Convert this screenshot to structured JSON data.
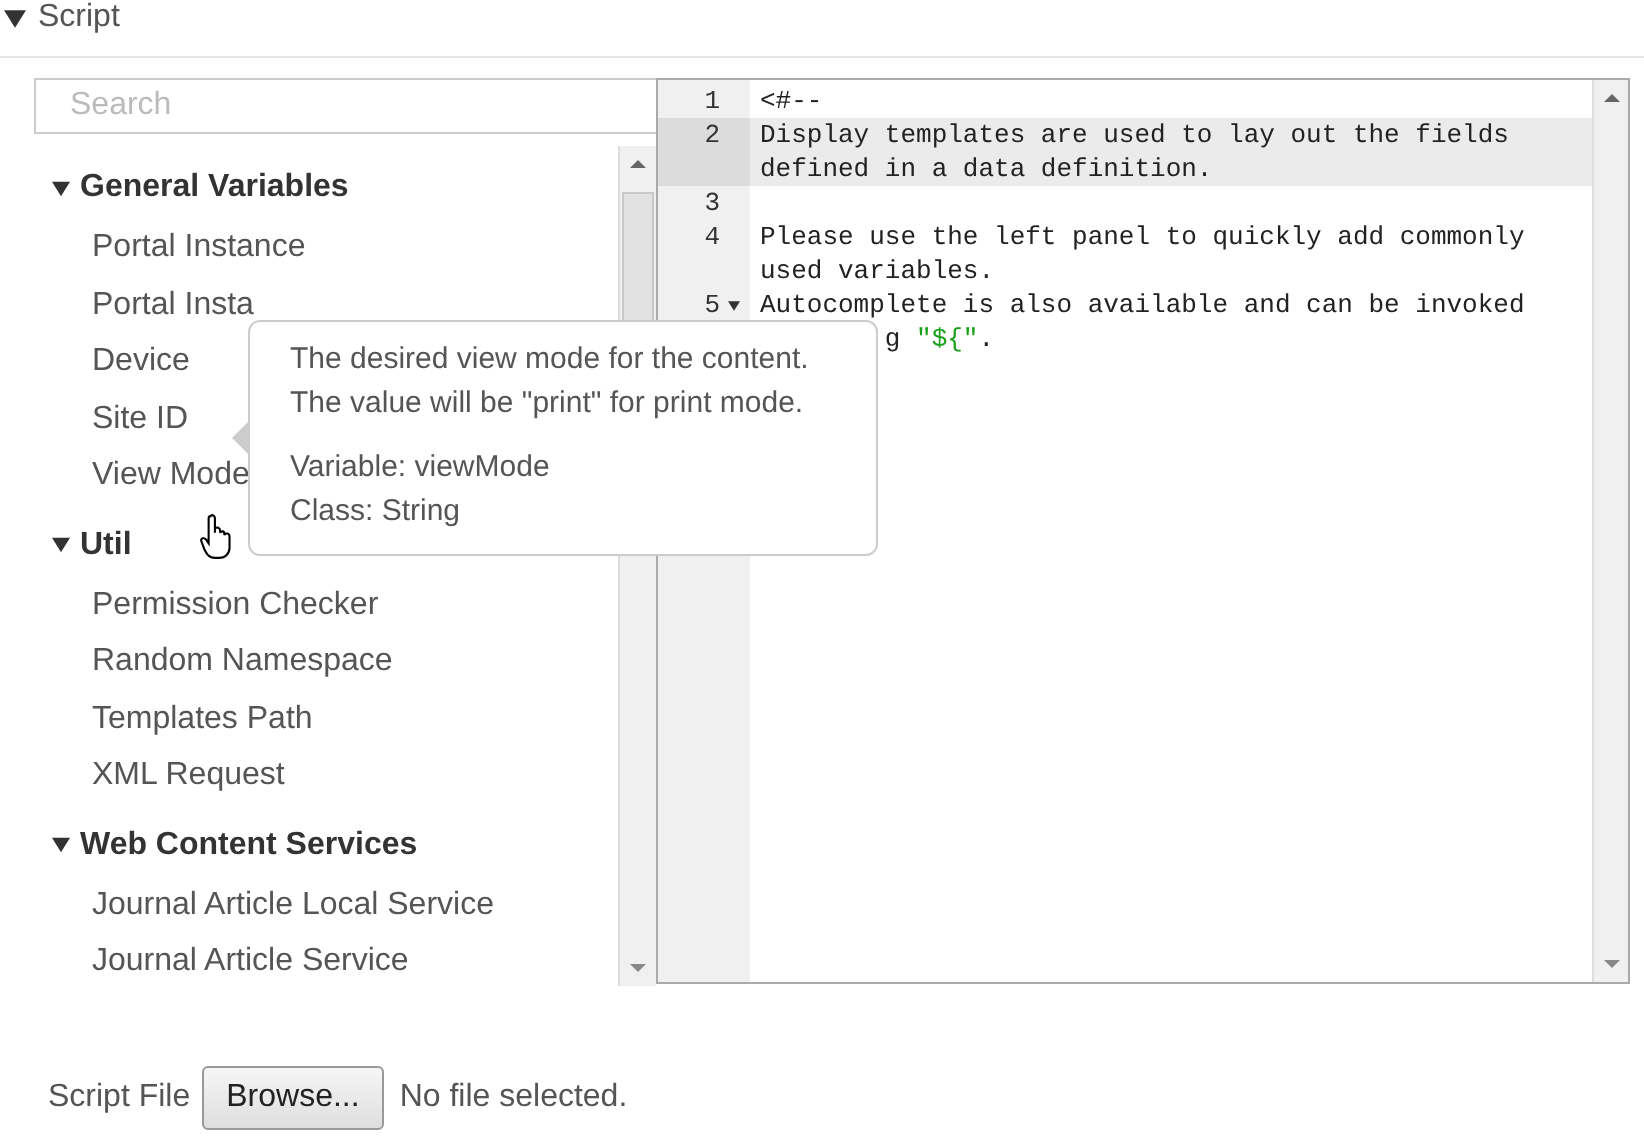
{
  "section": {
    "title": "Script",
    "expanded": true
  },
  "search": {
    "placeholder": "Search"
  },
  "variables": [
    {
      "label": "General Variables",
      "expanded": true,
      "children": [
        {
          "label": "Portal Instance"
        },
        {
          "label": "Portal Insta"
        },
        {
          "label": "Device"
        },
        {
          "label": "Site ID"
        },
        {
          "label": "View Mode"
        }
      ]
    },
    {
      "label": "Util",
      "expanded": true,
      "children": [
        {
          "label": "Permission Checker"
        },
        {
          "label": "Random Namespace"
        },
        {
          "label": "Templates Path"
        },
        {
          "label": "XML Request"
        }
      ]
    },
    {
      "label": "Web Content Services",
      "expanded": true,
      "children": [
        {
          "label": "Journal Article Local Service"
        },
        {
          "label": "Journal Article Service"
        }
      ]
    }
  ],
  "tooltip": {
    "description": [
      "The desired view mode for the content.",
      "The value will be \"print\" for print mode."
    ],
    "details": [
      "Variable: viewMode",
      "Class: String"
    ]
  },
  "editor": {
    "lines": [
      {
        "number": "1",
        "active": false,
        "foldable": false,
        "rows": [
          {
            "cut": false,
            "segments": [
              {
                "kind": "plain",
                "text": "<#--"
              }
            ]
          }
        ]
      },
      {
        "number": "2",
        "active": true,
        "foldable": false,
        "rows": [
          {
            "cut": false,
            "segments": [
              {
                "kind": "plain",
                "text": "Display templates are used to lay out the fields"
              }
            ]
          },
          {
            "cut": false,
            "segments": [
              {
                "kind": "plain",
                "text": "defined in a data definition."
              }
            ]
          }
        ]
      },
      {
        "number": "3",
        "active": false,
        "foldable": false,
        "rows": [
          {
            "cut": false,
            "segments": []
          }
        ]
      },
      {
        "number": "4",
        "active": false,
        "foldable": false,
        "rows": [
          {
            "cut": false,
            "segments": [
              {
                "kind": "plain",
                "text": "Please use the left panel to quickly add commonly"
              }
            ]
          },
          {
            "cut": false,
            "segments": [
              {
                "kind": "plain",
                "text": "used variables."
              }
            ]
          }
        ]
      },
      {
        "number": "5",
        "active": false,
        "foldable": true,
        "rows": [
          {
            "cut": false,
            "segments": [
              {
                "kind": "plain",
                "text": "Autocomplete is also available and can be invoked"
              }
            ]
          },
          {
            "cut": true,
            "segments": [
              {
                "kind": "plain",
                "text": "g "
              },
              {
                "kind": "string",
                "text": "\"${\""
              },
              {
                "kind": "plain",
                "text": "."
              }
            ]
          }
        ]
      }
    ]
  },
  "script_file": {
    "label": "Script File",
    "button": "Browse...",
    "status": "No file selected."
  }
}
